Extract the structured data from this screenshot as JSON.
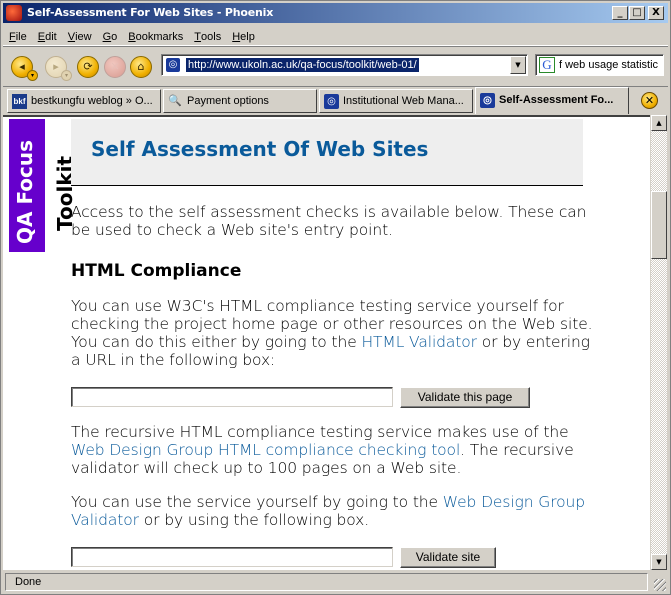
{
  "window": {
    "title": "Self-Assessment For Web Sites - Phoenix",
    "controls": {
      "minimize": "_",
      "maximize": "□",
      "close": "X"
    }
  },
  "menu": [
    "File",
    "Edit",
    "View",
    "Go",
    "Bookmarks",
    "Tools",
    "Help"
  ],
  "menu_access_keys": [
    "F",
    "E",
    "V",
    "G",
    "B",
    "T",
    "H"
  ],
  "toolbar": {
    "back_icon": "◂",
    "forward_icon": "▸",
    "reload_icon": "⟳",
    "stop_icon": "✕",
    "home_icon": "⌂",
    "dropdown_icon": "▾",
    "url": "http://www.ukoln.ac.uk/qa-focus/toolkit/web-01/",
    "url_dropdown_icon": "▼",
    "search_engine_icon": "G",
    "search_value": "f web usage statistic"
  },
  "tabs": [
    {
      "label": "bestkungfu weblog » O...",
      "icon": "bkf"
    },
    {
      "label": "Payment options",
      "icon": "magnifier"
    },
    {
      "label": "Institutional Web Mana...",
      "icon": "ukoln"
    },
    {
      "label": "Self-Assessment Fo...",
      "icon": "ukoln",
      "active": true
    }
  ],
  "tab_icon_text": {
    "bkf": "bkf",
    "ukoln": "◎",
    "magnifier": "🔍"
  },
  "close_tab_icon": "✕",
  "page": {
    "side_logo": "QA Focus",
    "side_label": "Toolkit",
    "heading": "Self Assessment Of Web Sites",
    "intro": "Access to the self assessment checks is available below. These can be used to check a Web site's entry point.",
    "section_heading": "HTML Compliance",
    "para1_before": "You can use W3C's HTML compliance testing service yourself for checking the project home page or other resources on the Web site. You can do this either by going to the ",
    "para1_link": "HTML Validator",
    "para1_after": " or by entering a URL in the following box:",
    "form1": {
      "input_value": "",
      "button": "Validate this page"
    },
    "para2_before": "The recursive HTML compliance testing service makes use of the ",
    "para2_link": "Web Design Group HTML compliance checking tool",
    "para2_after": ". The recursive validator will check up to 100 pages on a Web site.",
    "para3_before": "You can use the service yourself by going to the ",
    "para3_link": "Web Design Group Validator",
    "para3_after": " or by using the following box.",
    "form2": {
      "input_value": "",
      "button": "Validate site"
    },
    "link_color": "#0a5a9a",
    "logo_color": "#6600cc"
  },
  "scrollbar": {
    "up_icon": "▲",
    "down_icon": "▼"
  },
  "status": {
    "text": "Done"
  }
}
